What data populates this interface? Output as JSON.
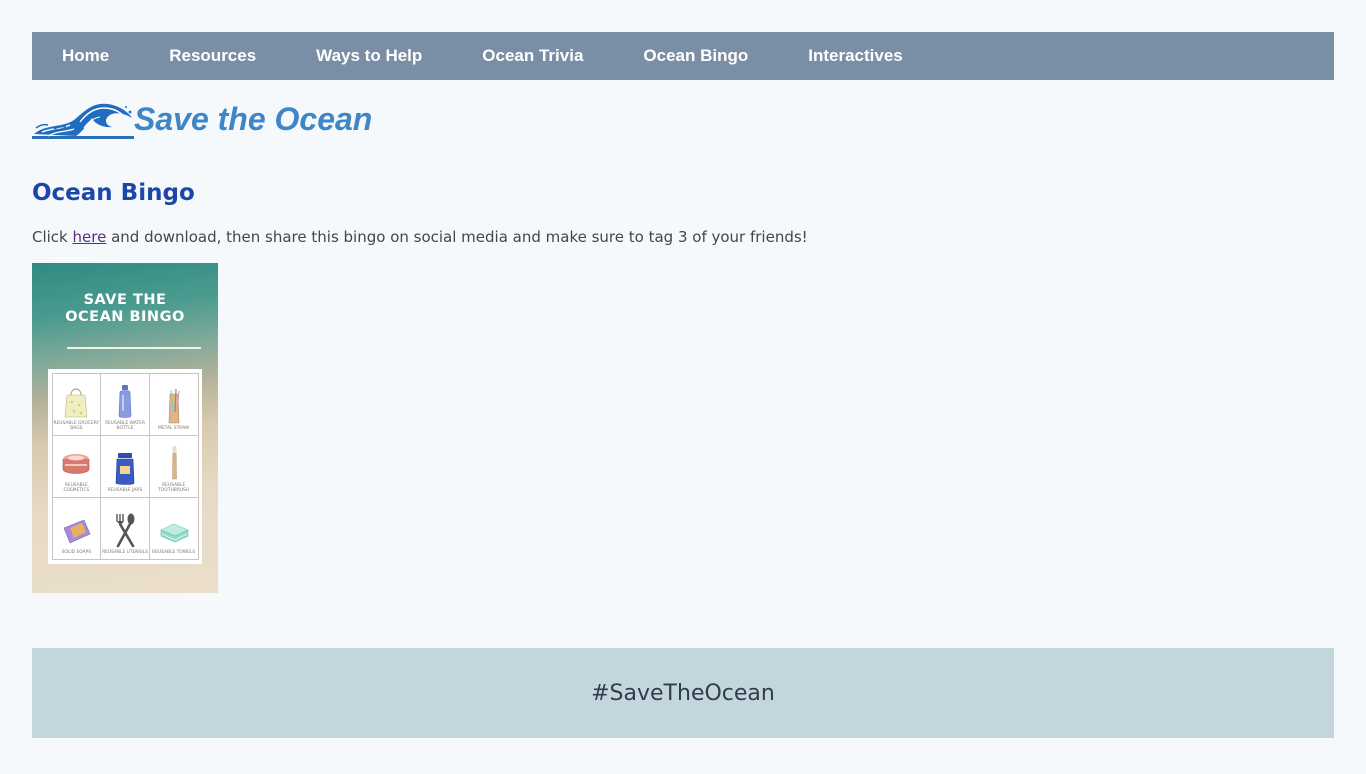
{
  "nav": {
    "items": [
      {
        "label": "Home"
      },
      {
        "label": "Resources"
      },
      {
        "label": "Ways to Help"
      },
      {
        "label": "Ocean Trivia"
      },
      {
        "label": "Ocean Bingo"
      },
      {
        "label": "Interactives"
      }
    ]
  },
  "brand": {
    "name": "Save the Ocean",
    "icon": "wave-icon",
    "color": "#3e86c6"
  },
  "page": {
    "title": "Ocean Bingo",
    "intro_before": "Click ",
    "intro_link": "here",
    "intro_after": " and download, then share this bingo on social media and make sure to tag 3 of your friends!"
  },
  "bingo_card": {
    "title_line1": "SAVE THE",
    "title_line2": "OCEAN BINGO",
    "cells": [
      {
        "label": "REUSABLE GROCERY BAGS",
        "icon": "tote-bag-icon"
      },
      {
        "label": "REUSABLE WATER BOTTLE",
        "icon": "water-bottle-icon"
      },
      {
        "label": "METAL STRAW",
        "icon": "metal-straw-icon"
      },
      {
        "label": "REUSABLE COSMETICS",
        "icon": "cosmetics-icon"
      },
      {
        "label": "REUSABLE JARS",
        "icon": "jar-icon"
      },
      {
        "label": "REUSABLE TOOTHBRUSH",
        "icon": "toothbrush-icon"
      },
      {
        "label": "SOLID SOAPS",
        "icon": "soap-icon"
      },
      {
        "label": "REUSABLE UTENSILS",
        "icon": "utensils-icon"
      },
      {
        "label": "REUSABLE TOWELS",
        "icon": "towels-icon"
      }
    ]
  },
  "footer": {
    "hashtag": "#SaveTheOcean"
  },
  "colors": {
    "nav_bg": "#7a8fa6",
    "title": "#1c47a8",
    "footer_bg": "#c4d6dd",
    "page_bg": "#f5f9fc"
  }
}
